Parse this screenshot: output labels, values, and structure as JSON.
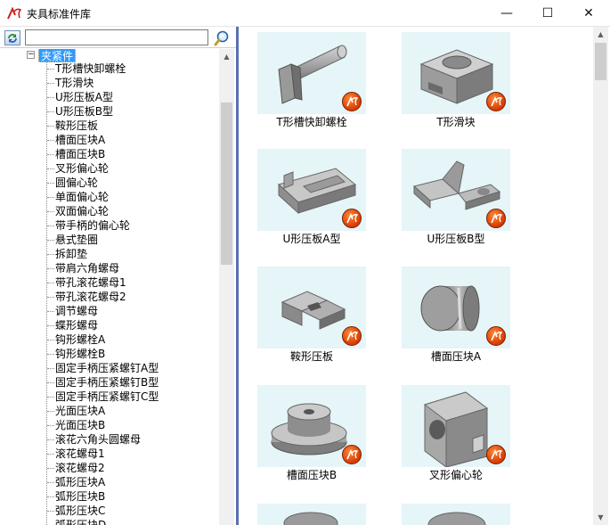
{
  "window": {
    "title": "夹具标准件库",
    "minimize_glyph": "—",
    "maximize_glyph": "☐",
    "close_glyph": "✕"
  },
  "search": {
    "value": "",
    "placeholder": ""
  },
  "tree": {
    "root_label": "夹紧件",
    "root_toggle": "−",
    "items": [
      "T形槽快卸螺栓",
      "T形滑块",
      "U形压板A型",
      "U形压板B型",
      "鞍形压板",
      "槽面压块A",
      "槽面压块B",
      "叉形偏心轮",
      "圆偏心轮",
      "单面偏心轮",
      "双面偏心轮",
      "带手柄的偏心轮",
      "悬式垫圈",
      "拆卸垫",
      "带肩六角螺母",
      "带孔滚花螺母1",
      "带孔滚花螺母2",
      "调节螺母",
      "蝶形螺母",
      "钩形螺栓A",
      "钩形螺栓B",
      "固定手柄压紧螺钉A型",
      "固定手柄压紧螺钉B型",
      "固定手柄压紧螺钉C型",
      "光面压块A",
      "光面压块B",
      "滚花六角头圆螺母",
      "滚花螺母1",
      "滚花螺母2",
      "弧形压块A",
      "弧形压块B",
      "弧形压块C",
      "弧形压块D"
    ]
  },
  "gallery": {
    "items": [
      {
        "label": "T形槽快卸螺栓",
        "icon": "t-slot-bolt-icon"
      },
      {
        "label": "T形滑块",
        "icon": "t-slider-icon"
      },
      {
        "label": "U形压板A型",
        "icon": "u-clamp-plate-a-icon"
      },
      {
        "label": "U形压板B型",
        "icon": "u-clamp-plate-b-icon"
      },
      {
        "label": "鞍形压板",
        "icon": "saddle-plate-icon"
      },
      {
        "label": "槽面压块A",
        "icon": "grooved-press-block-a-icon"
      },
      {
        "label": "槽面压块B",
        "icon": "grooved-press-block-b-icon"
      },
      {
        "label": "叉形偏心轮",
        "icon": "fork-eccentric-icon"
      }
    ]
  },
  "colors": {
    "selection": "#3399ff",
    "splitter": "#5b6fb2",
    "thumbnail_bg": "#e5f5f8",
    "part_gray": "#a8a8a8"
  }
}
